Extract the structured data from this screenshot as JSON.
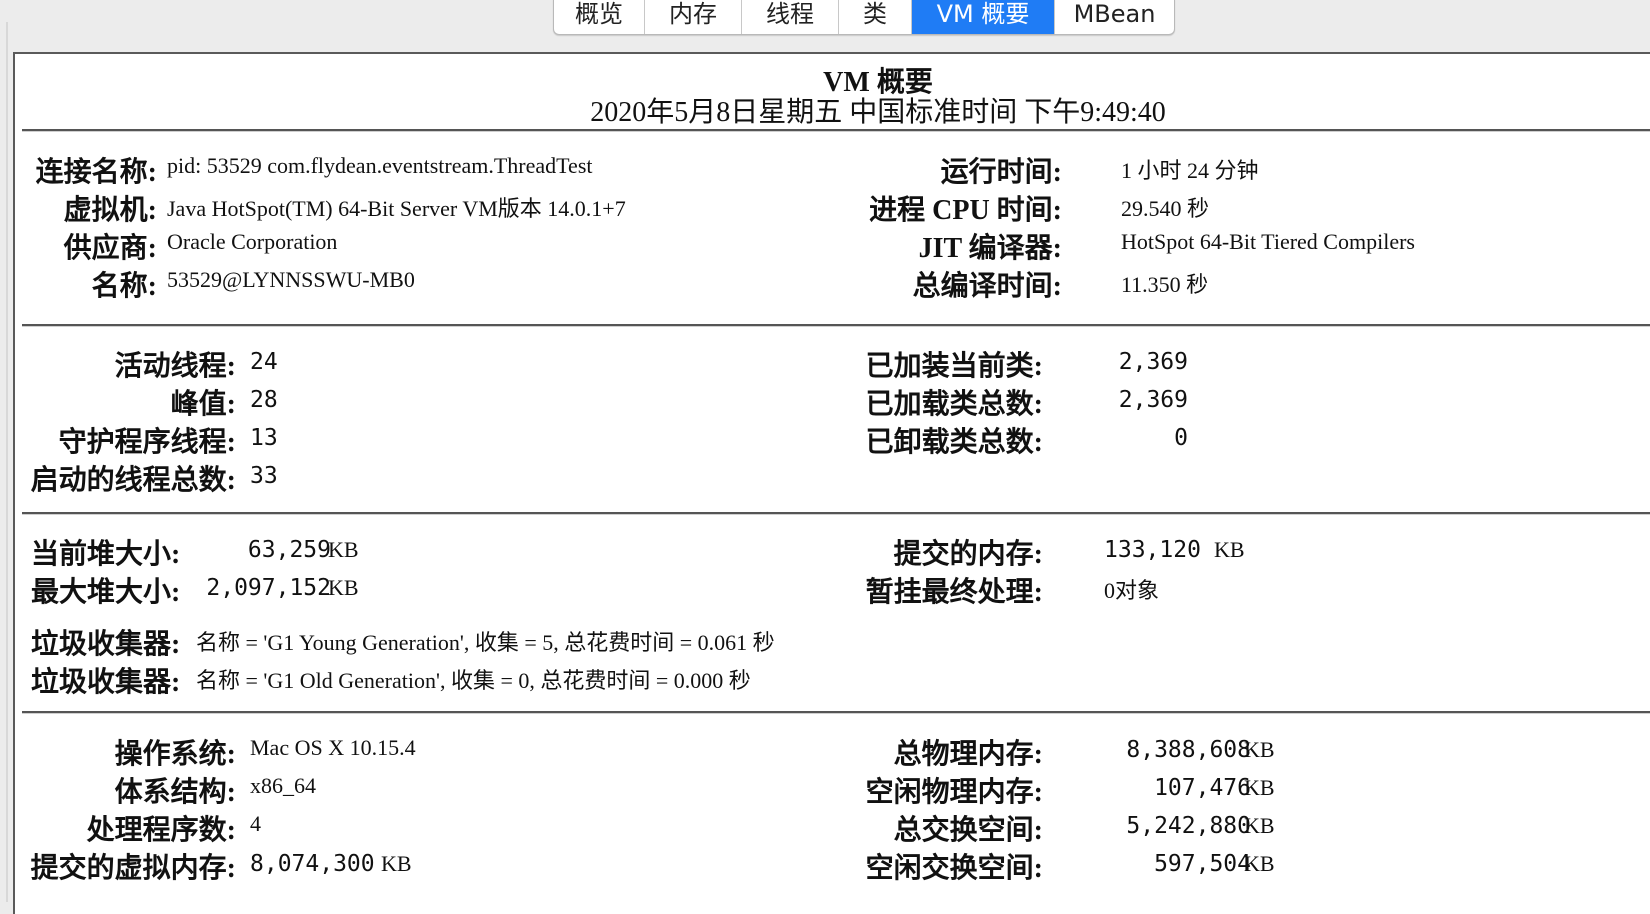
{
  "tabs": [
    "概览",
    "内存",
    "线程",
    "类",
    "VM 概要",
    "MBean"
  ],
  "active_tab": "VM 概要",
  "header": {
    "title": "VM 概要",
    "datetime": "2020年5月8日星期五 中国标准时间 下午9:49:40"
  },
  "vm_info": {
    "left": [
      {
        "label": "连接名称:",
        "value": "pid: 53529 com.flydean.eventstream.ThreadTest"
      },
      {
        "label": "虚拟机:",
        "value": "Java HotSpot(TM) 64-Bit Server VM版本 14.0.1+7"
      },
      {
        "label": "供应商:",
        "value": "Oracle Corporation"
      },
      {
        "label": "名称:",
        "value": "53529@LYNNSSWU-MB0"
      }
    ],
    "right": [
      {
        "label": "运行时间:",
        "value": "1 小时 24 分钟"
      },
      {
        "label": "进程 CPU 时间:",
        "value": "29.540 秒"
      },
      {
        "label": "JIT 编译器:",
        "value": "HotSpot 64-Bit Tiered Compilers"
      },
      {
        "label": "总编译时间:",
        "value": "11.350 秒"
      }
    ]
  },
  "threads": {
    "left": [
      {
        "label": "活动线程:",
        "value": "24"
      },
      {
        "label": "峰值:",
        "value": "28"
      },
      {
        "label": "守护程序线程:",
        "value": "13"
      },
      {
        "label": "启动的线程总数:",
        "value": "33"
      }
    ],
    "right": [
      {
        "label": "已加装当前类:",
        "value": "2,369"
      },
      {
        "label": "已加载类总数:",
        "value": "2,369"
      },
      {
        "label": "已卸载类总数:",
        "value": "0"
      }
    ]
  },
  "memory": {
    "left": [
      {
        "label": "当前堆大小:",
        "value": "63,259",
        "unit": "KB"
      },
      {
        "label": "最大堆大小:",
        "value": "2,097,152",
        "unit": "KB"
      }
    ],
    "right": [
      {
        "label": "提交的内存:",
        "value": "133,120",
        "unit": "KB"
      },
      {
        "label": "暂挂最终处理:",
        "value": "0对象"
      }
    ],
    "gc": [
      {
        "label": "垃圾收集器:",
        "value": "名称 = 'G1 Young Generation', 收集 = 5, 总花费时间 = 0.061 秒"
      },
      {
        "label": "垃圾收集器:",
        "value": "名称 = 'G1 Old Generation', 收集 = 0, 总花费时间 = 0.000 秒"
      }
    ]
  },
  "os": {
    "left": [
      {
        "label": "操作系统:",
        "value": "Mac OS X 10.15.4"
      },
      {
        "label": "体系结构:",
        "value": "x86_64"
      },
      {
        "label": "处理程序数:",
        "value": "4"
      },
      {
        "label": "提交的虚拟内存:",
        "value": "8,074,300",
        "unit": "KB"
      }
    ],
    "right": [
      {
        "label": "总物理内存:",
        "value": "8,388,608",
        "unit": "KB"
      },
      {
        "label": "空闲物理内存:",
        "value": "107,476",
        "unit": "KB"
      },
      {
        "label": "总交换空间:",
        "value": "5,242,880",
        "unit": "KB"
      },
      {
        "label": "空闲交换空间:",
        "value": "597,504",
        "unit": "KB"
      }
    ]
  }
}
